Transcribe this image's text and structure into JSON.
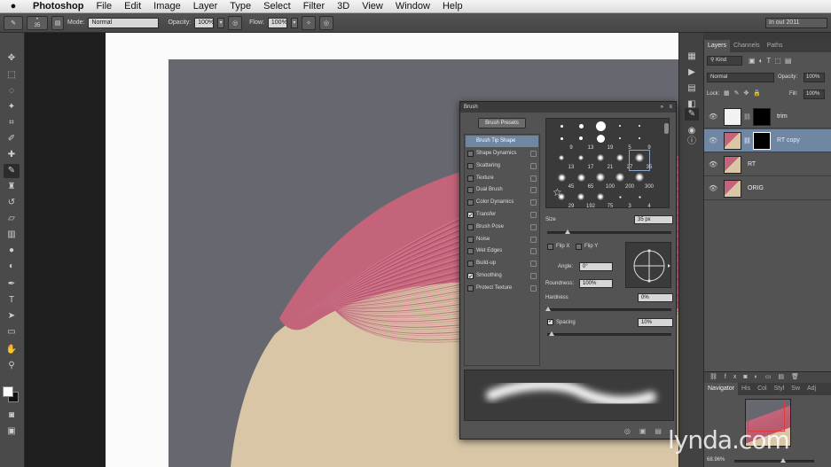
{
  "menubar": {
    "app_name": "Photoshop",
    "items": [
      "File",
      "Edit",
      "Image",
      "Layer",
      "Type",
      "Select",
      "Filter",
      "3D",
      "View",
      "Window",
      "Help"
    ]
  },
  "options_bar": {
    "brush_size": "35",
    "mode_label": "Mode:",
    "mode_value": "Normal",
    "opacity_label": "Opacity:",
    "opacity_value": "100%",
    "flow_label": "Flow:",
    "flow_value": "100%",
    "workspace": "In out 2011"
  },
  "layers_panel": {
    "tabs": [
      "Layers",
      "Channels",
      "Paths"
    ],
    "kind_filter": "Kind",
    "blend_mode": "Normal",
    "opacity_label": "Opacity:",
    "opacity_value": "100%",
    "lock_label": "Lock:",
    "fill_label": "Fill:",
    "fill_value": "100%",
    "layers": [
      {
        "name": "trim",
        "selected": false
      },
      {
        "name": "RT copy",
        "selected": true
      },
      {
        "name": "RT",
        "selected": false
      },
      {
        "name": "ORIG",
        "selected": false
      }
    ]
  },
  "navigator": {
    "tabs": [
      "Navigator",
      "His",
      "Col",
      "Styl",
      "Sw",
      "Adj"
    ],
    "zoom": "68.96%"
  },
  "brush_panel": {
    "title": "Brush",
    "presets_button": "Brush Presets",
    "tip_shape": "Brush Tip Shape",
    "options": [
      {
        "label": "Shape Dynamics",
        "checked": false
      },
      {
        "label": "Scattering",
        "checked": false
      },
      {
        "label": "Texture",
        "checked": false
      },
      {
        "label": "Dual Brush",
        "checked": false
      },
      {
        "label": "Color Dynamics",
        "checked": false
      },
      {
        "label": "Transfer",
        "checked": true
      },
      {
        "label": "Brush Pose",
        "checked": false
      },
      {
        "label": "Noise",
        "checked": false
      },
      {
        "label": "Wet Edges",
        "checked": false
      },
      {
        "label": "Build-up",
        "checked": false
      },
      {
        "label": "Smoothing",
        "checked": true
      },
      {
        "label": "Protect Texture",
        "checked": false
      }
    ],
    "tips": [
      "9",
      "13",
      "19",
      "5",
      "9",
      "13",
      "17",
      "21",
      "27",
      "35",
      "45",
      "65",
      "100",
      "200",
      "300",
      "29",
      "192",
      "75",
      "3",
      "4"
    ],
    "size_label": "Size",
    "size_value": "35 px",
    "flip_x": "Flip X",
    "flip_y": "Flip Y",
    "angle_label": "Angle:",
    "angle_value": "0°",
    "roundness_label": "Roundness:",
    "roundness_value": "100%",
    "hardness_label": "Hardness",
    "hardness_value": "0%",
    "spacing_label": "Spacing",
    "spacing_value": "10%"
  },
  "watermark": "lynda.com",
  "colors": {
    "hair": "#c4647a",
    "backdrop": "#67676f",
    "skin": "#d8c6a6",
    "selected_layer": "#6f87a3"
  }
}
